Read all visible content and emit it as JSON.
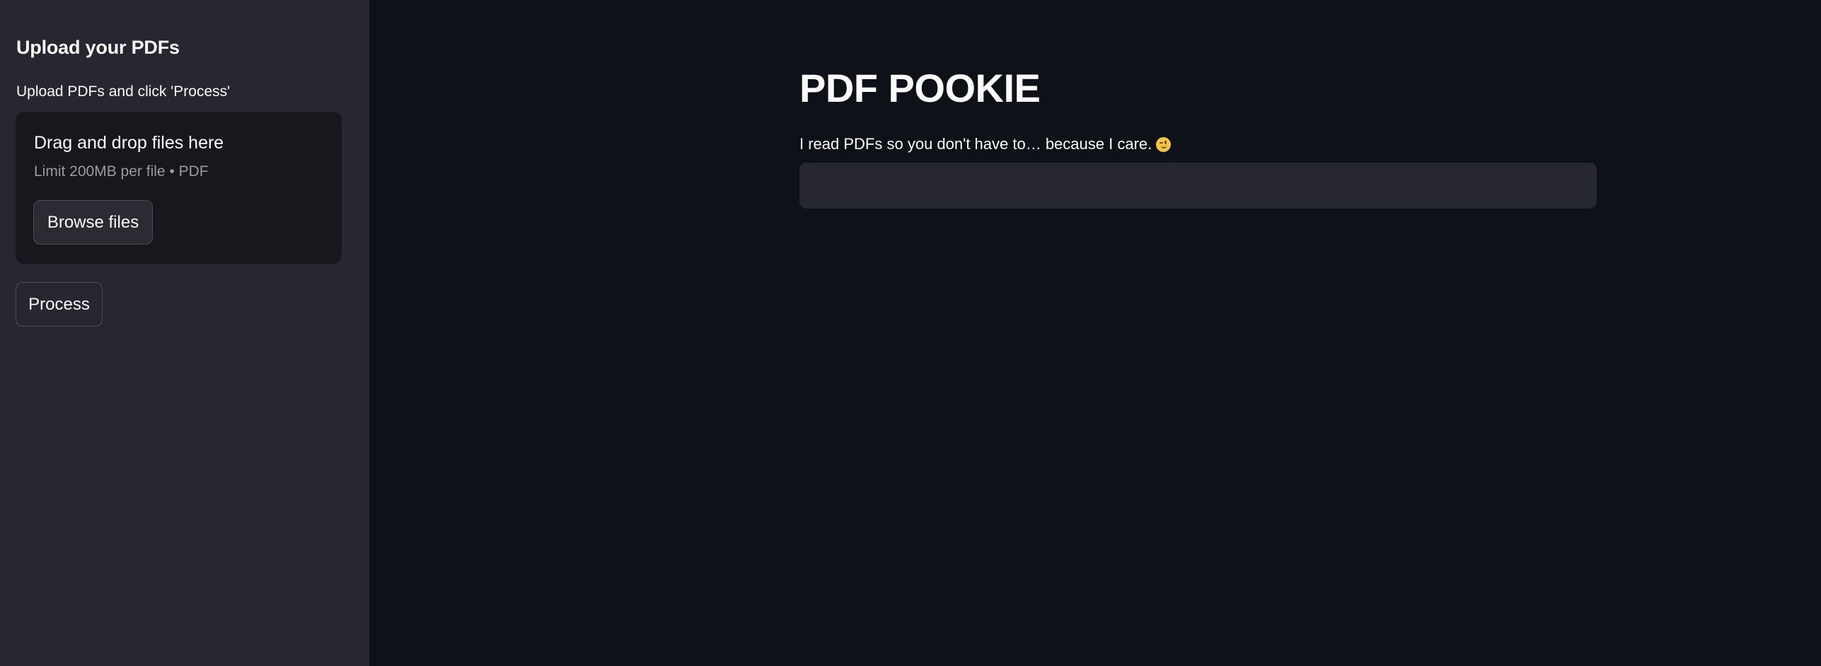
{
  "sidebar": {
    "title": "Upload your PDFs",
    "uploader": {
      "label": "Upload PDFs and click 'Process'",
      "instructions": "Drag and drop files here",
      "limit_text": "Limit 200MB per file • PDF",
      "browse_label": "Browse files"
    },
    "process_label": "Process"
  },
  "main": {
    "title": "PDF POOKIE",
    "subtitle": "I read PDFs so you don't have to… because I care.",
    "subtitle_emoji": "winking-face-icon",
    "question_input": {
      "value": "",
      "placeholder": ""
    }
  },
  "colors": {
    "main_background": "#0e1117",
    "sidebar_background": "#262730",
    "dropzone_background": "#17181e",
    "text": "#fafafa",
    "muted_text": "#9a9ba1"
  }
}
